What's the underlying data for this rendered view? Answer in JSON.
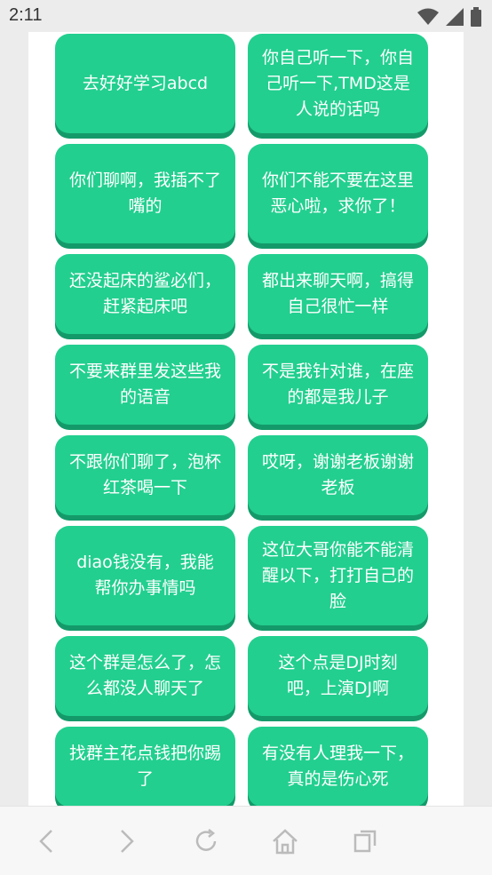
{
  "status_bar": {
    "time": "2:11",
    "icons": [
      "wifi-icon",
      "signal-icon",
      "battery-icon"
    ]
  },
  "phrases": [
    "去好好学习abcd",
    "你自己听一下，你自己听一下,TMD这是人说的话吗",
    "你们聊啊，我插不了嘴的",
    "你们不能不要在这里恶心啦，求你了！",
    "还没起床的鲨必们，赶紧起床吧",
    "都出来聊天啊，搞得自己很忙一样",
    "不要来群里发这些我的语音",
    "不是我针对谁，在座的都是我儿子",
    "不跟你们聊了，泡杯红茶喝一下",
    "哎呀，谢谢老板谢谢老板",
    "diao钱没有，我能帮你办事情吗",
    "这位大哥你能不能清醒以下，打打自己的脸",
    "这个群是怎么了，怎么都没人聊天了",
    "这个点是DJ时刻吧，上演DJ啊",
    "找群主花点钱把你踢了",
    "有没有人理我一下，真的是伤心死"
  ],
  "colors": {
    "button_bg": "#22cf8f",
    "button_shadow": "#149a6a",
    "page_bg": "#ececec"
  },
  "bottom_nav": {
    "icons": [
      "back-arrow-icon",
      "forward-arrow-icon",
      "refresh-icon",
      "home-icon",
      "tabs-icon"
    ]
  }
}
